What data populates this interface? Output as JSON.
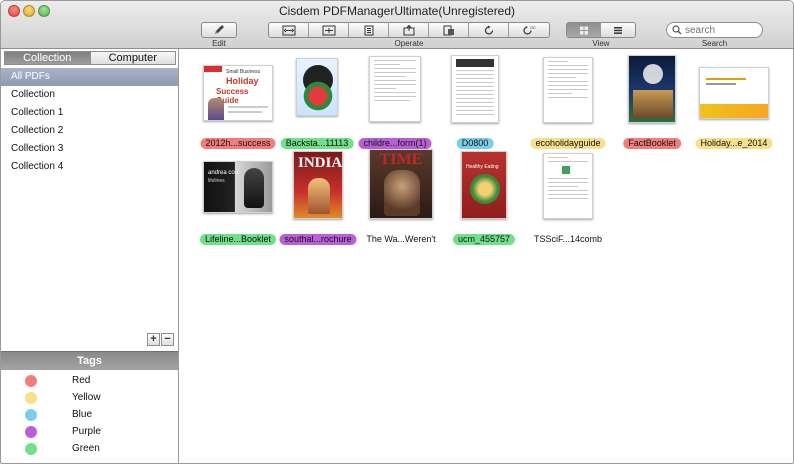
{
  "window": {
    "title": "Cisdem PDFManagerUltimate(Unregistered)"
  },
  "toolbar": {
    "edit_label": "Edit",
    "operate_label": "Operate",
    "view_label": "View",
    "search_label": "Search",
    "search_placeholder": "search",
    "operate_icons": [
      "split-icon",
      "merge-icon",
      "compress-icon",
      "extract-icon",
      "encrypt-icon",
      "rotate-icon",
      "ocr-icon"
    ]
  },
  "sidebar": {
    "tabs": [
      "Collection",
      "Computer"
    ],
    "items": [
      "All PDFs",
      "Collection",
      "Collection 1",
      "Collection 2",
      "Collection 3",
      "Collection 4"
    ],
    "tags_header": "Tags",
    "tags": [
      {
        "label": "Red",
        "color": "#f37d7d"
      },
      {
        "label": "Yellow",
        "color": "#f7e08c"
      },
      {
        "label": "Blue",
        "color": "#79cfe8"
      },
      {
        "label": "Purple",
        "color": "#bb5fd8"
      },
      {
        "label": "Green",
        "color": "#71e08a"
      }
    ],
    "add_label": "+",
    "remove_label": "−"
  },
  "documents": [
    {
      "name": "2012h...success",
      "tag_color": "#f37d7d",
      "thumb_lines": [
        "Small Business",
        "Holiday",
        "Success Guide"
      ]
    },
    {
      "name": "Backsta...11113",
      "tag_color": "#71e08a"
    },
    {
      "name": "childre...form(1)",
      "tag_color": "#bb5fd8"
    },
    {
      "name": "D0800",
      "tag_color": "#79cfe8"
    },
    {
      "name": "ecoholidayguide",
      "tag_color": "#f7e08c"
    },
    {
      "name": "FactBooklet",
      "tag_color": "#f37d7d"
    },
    {
      "name": "Holiday...e_2014",
      "tag_color": "#f7e08c"
    },
    {
      "name": "Lifeline...Booklet",
      "tag_color": "#71e08a",
      "thumb_lines": [
        "andrea corr",
        "lifelines"
      ]
    },
    {
      "name": "southal...rochure",
      "tag_color": "#bb5fd8",
      "thumb_lines": [
        "INDIA"
      ]
    },
    {
      "name": "The Wa...Weren't",
      "tag_color": "",
      "thumb_lines": [
        "TIME"
      ]
    },
    {
      "name": "ucm_455757",
      "tag_color": "#71e08a",
      "thumb_lines": [
        "Healthy Eating"
      ]
    },
    {
      "name": "TSSciF...14comb",
      "tag_color": ""
    }
  ]
}
